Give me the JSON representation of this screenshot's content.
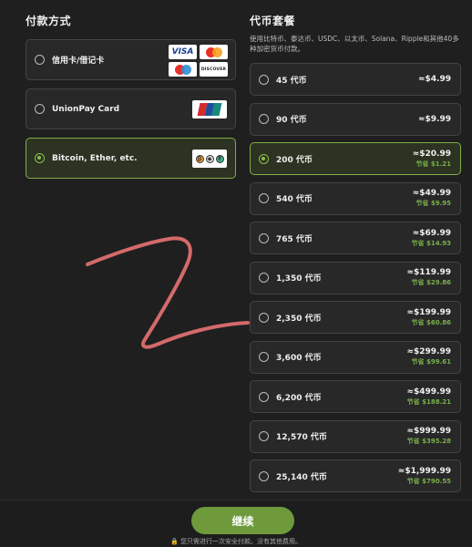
{
  "payment": {
    "title": "付款方式",
    "methods": [
      {
        "label": "信用卡/借记卡",
        "selected": false,
        "logos": [
          "visa",
          "mastercard",
          "maestro",
          "discover"
        ]
      },
      {
        "label": "UnionPay Card",
        "selected": false,
        "logos": [
          "unionpay"
        ]
      },
      {
        "label": "Bitcoin, Ether, etc.",
        "selected": true,
        "logos": [
          "crypto-coins"
        ]
      }
    ],
    "logo_text": {
      "visa": "VISA",
      "discover": "DISCOVER"
    }
  },
  "packages": {
    "title": "代币套餐",
    "description": "使用比特币、泰达币、USDC、以太币、Solana、Ripple和其他40多种加密货币付款。",
    "items": [
      {
        "label": "45 代币",
        "price": "≈$4.99",
        "save": "",
        "selected": false
      },
      {
        "label": "90 代币",
        "price": "≈$9.99",
        "save": "",
        "selected": false
      },
      {
        "label": "200 代币",
        "price": "≈$20.99",
        "save": "节省 $1.21",
        "selected": true
      },
      {
        "label": "540 代币",
        "price": "≈$49.99",
        "save": "节省 $9.95",
        "selected": false
      },
      {
        "label": "765 代币",
        "price": "≈$69.99",
        "save": "节省 $14.93",
        "selected": false
      },
      {
        "label": "1,350 代币",
        "price": "≈$119.99",
        "save": "节省 $29.86",
        "selected": false
      },
      {
        "label": "2,350 代币",
        "price": "≈$199.99",
        "save": "节省 $60.86",
        "selected": false
      },
      {
        "label": "3,600 代币",
        "price": "≈$299.99",
        "save": "节省 $99.61",
        "selected": false
      },
      {
        "label": "6,200 代币",
        "price": "≈$499.99",
        "save": "节省 $188.21",
        "selected": false
      },
      {
        "label": "12,570 代币",
        "price": "≈$999.99",
        "save": "节省 $395.28",
        "selected": false
      },
      {
        "label": "25,140 代币",
        "price": "≈$1,999.99",
        "save": "节省 $790.55",
        "selected": false
      }
    ]
  },
  "footer": {
    "continue_label": "继续",
    "secure_note": "🔒 您只需进行一次安全付款。没有其他费用。"
  },
  "colors": {
    "accent": "#7fae45",
    "button": "#6f9a3c",
    "savings": "#79b04a",
    "scribble": "#d46a6a"
  }
}
